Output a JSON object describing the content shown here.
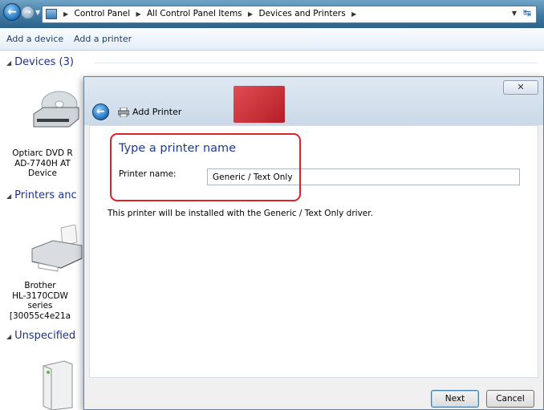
{
  "address_bar": {
    "crumbs": [
      "Control Panel",
      "All Control Panel Items",
      "Devices and Printers"
    ]
  },
  "command_bar": {
    "add_device": "Add a device",
    "add_printer": "Add a printer"
  },
  "explorer": {
    "groups": [
      {
        "title": "Devices (3)"
      },
      {
        "title": "Printers anc"
      },
      {
        "title": "Unspecified"
      }
    ],
    "devices": [
      {
        "lines": [
          "Optiarc DVD R",
          "AD-7740H AT",
          "Device"
        ]
      },
      {
        "lines": [
          "Brother",
          "HL-3170CDW",
          "series",
          "[30055c4e21a"
        ]
      }
    ]
  },
  "dialog": {
    "close_symbol": "✕",
    "title": "Add Printer",
    "heading": "Type a printer name",
    "printer_name_label": "Printer name:",
    "printer_name_value": "Generic / Text Only",
    "info": "This printer will be installed with the Generic / Text Only driver.",
    "next_label": "Next",
    "cancel_label": "Cancel"
  },
  "colors": {
    "heading": "#1e3b8f",
    "highlight": "#e0202a",
    "group_header": "#1e3287"
  }
}
